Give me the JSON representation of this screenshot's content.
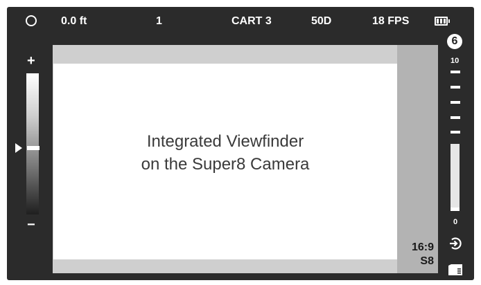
{
  "topbar": {
    "distance": "0.0 ft",
    "take": "1",
    "cartridge": "CART 3",
    "filmstock": "50D",
    "framerate": "18 FPS"
  },
  "exposure": {
    "plus": "+",
    "minus": "−"
  },
  "viewfinder": {
    "caption_line1": "Integrated Viewfinder",
    "caption_line2": "on the Super8 Camera",
    "aspect": "16:9",
    "format": "S8"
  },
  "meter": {
    "badge": "6",
    "max": "10",
    "min": "0"
  }
}
